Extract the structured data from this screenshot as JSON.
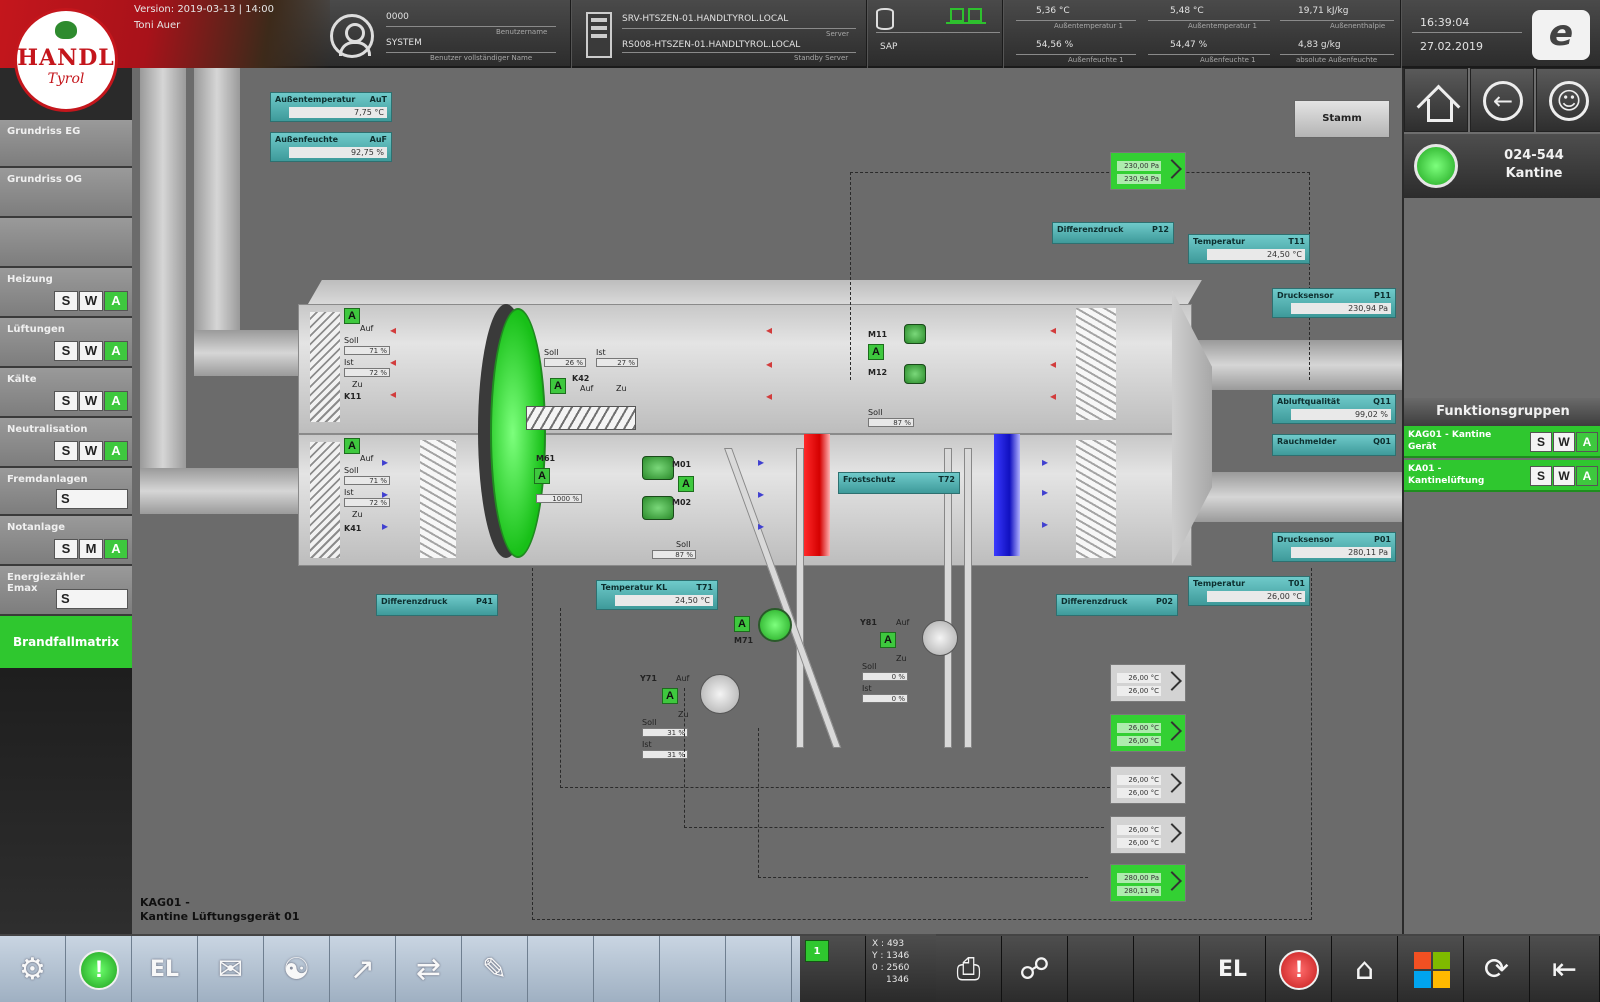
{
  "header": {
    "version": "Version: 2019-03-13 | 14:00",
    "username": "Toni Auer",
    "user_id": "0000",
    "user_id_label": "Benutzername",
    "user_group": "SYSTEM",
    "user_group_label": "Benutzer vollständiger Name",
    "server_1": "SRV-HTSZEN-01.HANDLTYROL.LOCAL",
    "server_1_label": "Server",
    "server_2": "RS008-HTSZEN-01.HANDLTYROL.LOCAL",
    "server_2_label": "Standby Server",
    "db_label": "SAP",
    "outdoor_temp": "5,36 °C",
    "outdoor_temp_label": "Außentemperatur 1",
    "outdoor_temp_2": "5,48 °C",
    "outdoor_temp_2_label": "Außentemperatur 1",
    "enthalpy": "19,71 kJ/kg",
    "enthalpy_label": "Außenenthalpie",
    "humidity": "54,56 %",
    "humidity_label": "Außenfeuchte 1",
    "humidity_2": "54,47 %",
    "humidity_2_label": "Außenfeuchte 1",
    "abs_humidity": "4,83 g/kg",
    "abs_humidity_label": "absolute Außenfeuchte",
    "time": "16:39:04",
    "date": "27.02.2019",
    "logo_text_1": "HANDL",
    "logo_text_2": "Tyrol",
    "e_logo": "e"
  },
  "sidebar": {
    "items": [
      {
        "label": "Grundriss EG"
      },
      {
        "label": "Grundriss OG"
      },
      {
        "label": ""
      },
      {
        "label": "Heizung",
        "btns": [
          "S",
          "W",
          "A"
        ]
      },
      {
        "label": "Lüftungen",
        "btns": [
          "S",
          "W",
          "A"
        ]
      },
      {
        "label": "Kälte",
        "btns": [
          "S",
          "W",
          "A"
        ]
      },
      {
        "label": "Neutralisation",
        "btns": [
          "S",
          "W",
          "A"
        ]
      },
      {
        "label": "Fremdanlagen",
        "single": "S"
      },
      {
        "label": "Notanlage",
        "btns": [
          "S",
          "M",
          "A"
        ]
      },
      {
        "label": "Energiezähler Emax",
        "single": "S"
      }
    ],
    "brandfall": "Brandfallmatrix"
  },
  "right_panel": {
    "room_id": "024-544",
    "room_name": "Kantine",
    "function_groups_title": "Funktionsgruppen",
    "groups": [
      {
        "label": "KAG01 - Kantine Gerät",
        "btns": [
          "S",
          "W",
          "A"
        ]
      },
      {
        "label": "KA01 - Kantinelüftung",
        "btns": [
          "S",
          "W",
          "A"
        ]
      }
    ]
  },
  "main": {
    "sticky_button": "Stamm",
    "caption_1": "KAG01 -",
    "caption_2": "Kantine Lüftungsgerät 01",
    "sensors": {
      "outside_temp": {
        "name": "Außentemperatur",
        "tag": "AuT",
        "value": "7,75 °C"
      },
      "outside_humidity": {
        "name": "Außenfeuchte",
        "tag": "AuF",
        "value": "92,75 %"
      },
      "diff_p12": {
        "name": "Differenzdruck",
        "tag": "P12",
        "value": ""
      },
      "temp_t11": {
        "name": "Temperatur",
        "tag": "T11",
        "value": "24,50 °C"
      },
      "druck_p11": {
        "name": "Drucksensor",
        "tag": "P11",
        "value": "230,94 Pa"
      },
      "abluft_q11": {
        "name": "Abluftqualität",
        "tag": "Q11",
        "value": "99,02 %"
      },
      "rauch_q01": {
        "name": "Rauchmelder",
        "tag": "Q01",
        "value": ""
      },
      "druck_p01": {
        "name": "Drucksensor",
        "tag": "P01",
        "value": "280,11 Pa"
      },
      "temp_t01": {
        "name": "Temperatur",
        "tag": "T01",
        "value": "26,00 °C"
      },
      "diff_p02": {
        "name": "Differenzdruck",
        "tag": "P02",
        "value": ""
      },
      "diff_p41": {
        "name": "Differenzdruck",
        "tag": "P41",
        "value": ""
      },
      "temp_t71": {
        "name": "Temperatur KL",
        "tag": "T71",
        "value": "24,50 °C"
      },
      "frost_t72": {
        "name": "Frostschutz",
        "tag": "T72",
        "value": ""
      }
    },
    "setpoints": [
      {
        "v1": "230,00 Pa",
        "v2": "230,94 Pa",
        "green": true
      },
      {
        "v1": "26,00 °C",
        "v2": "26,00 °C",
        "green": false
      },
      {
        "v1": "26,00 °C",
        "v2": "26,00 °C",
        "green": true
      },
      {
        "v1": "26,00 °C",
        "v2": "26,00 °C",
        "green": false
      },
      {
        "v1": "26,00 °C",
        "v2": "26,00 °C",
        "green": false
      },
      {
        "v1": "280,00 Pa",
        "v2": "280,11 Pa",
        "green": true
      }
    ],
    "labels": {
      "k11": "K11",
      "k41": "K41",
      "k42": "K42",
      "m11": "M11",
      "m12": "M12",
      "m01": "M01",
      "m02": "M02",
      "m61": "M61",
      "m71": "M71",
      "y71": "Y71",
      "y81": "Y81",
      "auf": "Auf",
      "zu": "Zu",
      "soll": "Soll",
      "ist": "Ist",
      "a": "A",
      "m": "M"
    },
    "values": {
      "k11_soll": "71 %",
      "k11_ist": "72 %",
      "k41_soll": "71 %",
      "k41_ist": "72 %",
      "k42_soll": "26 %",
      "k42_ist": "27 %",
      "m11_soll": "87 %",
      "m01_soll": "87 %",
      "m61_val": "1000 %",
      "y71_soll": "31 %",
      "y71_ist": "31 %",
      "y81_soll": "0 %",
      "y81_ist": "0 %"
    }
  },
  "bottom": {
    "badge": "1",
    "x_label": "X :",
    "x_val": "493",
    "y_label": "Y :",
    "y_val": "1346",
    "z_label": "0 :",
    "z_val": "2560",
    "z2_val": "1346",
    "el_label": "EL"
  },
  "colors": {
    "accent_green": "#2fc72f",
    "brand_red": "#c4161c",
    "sensor_teal": "#5fbcbc",
    "heater_red": "#e00000",
    "cooler_blue": "#2020e0"
  }
}
